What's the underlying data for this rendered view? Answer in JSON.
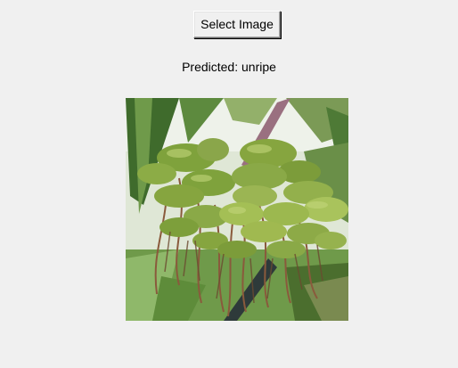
{
  "window": {
    "background": "#f0f0f0"
  },
  "toolbar": {
    "select_image_label": "Select Image"
  },
  "result": {
    "prediction_text": "Predicted: unripe"
  },
  "photo": {
    "subject": "green mango cluster on tree",
    "colors": {
      "sky": "#eef2ea",
      "leaf_dark": "#3f6b2c",
      "leaf_mid": "#6f9a4a",
      "fruit": "#7fa23c",
      "fruit_light": "#a9c35c",
      "stem": "#8a5a3c",
      "grass": "#5e8c3a"
    }
  }
}
